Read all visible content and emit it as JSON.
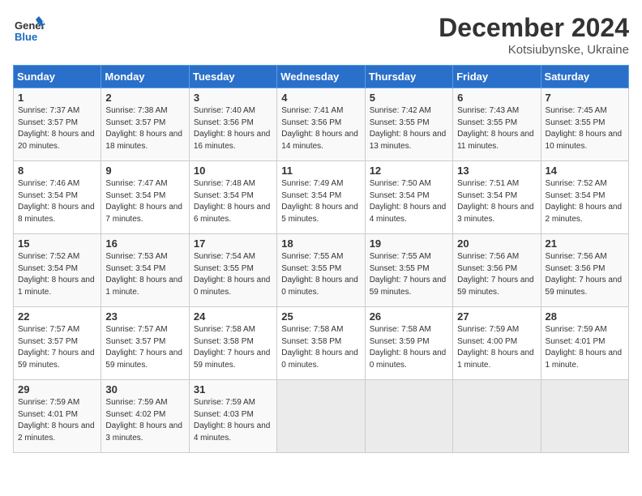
{
  "logo": {
    "general": "General",
    "blue": "Blue"
  },
  "title": "December 2024",
  "location": "Kotsiubynske, Ukraine",
  "weekdays": [
    "Sunday",
    "Monday",
    "Tuesday",
    "Wednesday",
    "Thursday",
    "Friday",
    "Saturday"
  ],
  "weeks": [
    [
      {
        "day": "1",
        "sunrise": "Sunrise: 7:37 AM",
        "sunset": "Sunset: 3:57 PM",
        "daylight": "Daylight: 8 hours and 20 minutes."
      },
      {
        "day": "2",
        "sunrise": "Sunrise: 7:38 AM",
        "sunset": "Sunset: 3:57 PM",
        "daylight": "Daylight: 8 hours and 18 minutes."
      },
      {
        "day": "3",
        "sunrise": "Sunrise: 7:40 AM",
        "sunset": "Sunset: 3:56 PM",
        "daylight": "Daylight: 8 hours and 16 minutes."
      },
      {
        "day": "4",
        "sunrise": "Sunrise: 7:41 AM",
        "sunset": "Sunset: 3:56 PM",
        "daylight": "Daylight: 8 hours and 14 minutes."
      },
      {
        "day": "5",
        "sunrise": "Sunrise: 7:42 AM",
        "sunset": "Sunset: 3:55 PM",
        "daylight": "Daylight: 8 hours and 13 minutes."
      },
      {
        "day": "6",
        "sunrise": "Sunrise: 7:43 AM",
        "sunset": "Sunset: 3:55 PM",
        "daylight": "Daylight: 8 hours and 11 minutes."
      },
      {
        "day": "7",
        "sunrise": "Sunrise: 7:45 AM",
        "sunset": "Sunset: 3:55 PM",
        "daylight": "Daylight: 8 hours and 10 minutes."
      }
    ],
    [
      {
        "day": "8",
        "sunrise": "Sunrise: 7:46 AM",
        "sunset": "Sunset: 3:54 PM",
        "daylight": "Daylight: 8 hours and 8 minutes."
      },
      {
        "day": "9",
        "sunrise": "Sunrise: 7:47 AM",
        "sunset": "Sunset: 3:54 PM",
        "daylight": "Daylight: 8 hours and 7 minutes."
      },
      {
        "day": "10",
        "sunrise": "Sunrise: 7:48 AM",
        "sunset": "Sunset: 3:54 PM",
        "daylight": "Daylight: 8 hours and 6 minutes."
      },
      {
        "day": "11",
        "sunrise": "Sunrise: 7:49 AM",
        "sunset": "Sunset: 3:54 PM",
        "daylight": "Daylight: 8 hours and 5 minutes."
      },
      {
        "day": "12",
        "sunrise": "Sunrise: 7:50 AM",
        "sunset": "Sunset: 3:54 PM",
        "daylight": "Daylight: 8 hours and 4 minutes."
      },
      {
        "day": "13",
        "sunrise": "Sunrise: 7:51 AM",
        "sunset": "Sunset: 3:54 PM",
        "daylight": "Daylight: 8 hours and 3 minutes."
      },
      {
        "day": "14",
        "sunrise": "Sunrise: 7:52 AM",
        "sunset": "Sunset: 3:54 PM",
        "daylight": "Daylight: 8 hours and 2 minutes."
      }
    ],
    [
      {
        "day": "15",
        "sunrise": "Sunrise: 7:52 AM",
        "sunset": "Sunset: 3:54 PM",
        "daylight": "Daylight: 8 hours and 1 minute."
      },
      {
        "day": "16",
        "sunrise": "Sunrise: 7:53 AM",
        "sunset": "Sunset: 3:54 PM",
        "daylight": "Daylight: 8 hours and 1 minute."
      },
      {
        "day": "17",
        "sunrise": "Sunrise: 7:54 AM",
        "sunset": "Sunset: 3:55 PM",
        "daylight": "Daylight: 8 hours and 0 minutes."
      },
      {
        "day": "18",
        "sunrise": "Sunrise: 7:55 AM",
        "sunset": "Sunset: 3:55 PM",
        "daylight": "Daylight: 8 hours and 0 minutes."
      },
      {
        "day": "19",
        "sunrise": "Sunrise: 7:55 AM",
        "sunset": "Sunset: 3:55 PM",
        "daylight": "Daylight: 7 hours and 59 minutes."
      },
      {
        "day": "20",
        "sunrise": "Sunrise: 7:56 AM",
        "sunset": "Sunset: 3:56 PM",
        "daylight": "Daylight: 7 hours and 59 minutes."
      },
      {
        "day": "21",
        "sunrise": "Sunrise: 7:56 AM",
        "sunset": "Sunset: 3:56 PM",
        "daylight": "Daylight: 7 hours and 59 minutes."
      }
    ],
    [
      {
        "day": "22",
        "sunrise": "Sunrise: 7:57 AM",
        "sunset": "Sunset: 3:57 PM",
        "daylight": "Daylight: 7 hours and 59 minutes."
      },
      {
        "day": "23",
        "sunrise": "Sunrise: 7:57 AM",
        "sunset": "Sunset: 3:57 PM",
        "daylight": "Daylight: 7 hours and 59 minutes."
      },
      {
        "day": "24",
        "sunrise": "Sunrise: 7:58 AM",
        "sunset": "Sunset: 3:58 PM",
        "daylight": "Daylight: 7 hours and 59 minutes."
      },
      {
        "day": "25",
        "sunrise": "Sunrise: 7:58 AM",
        "sunset": "Sunset: 3:58 PM",
        "daylight": "Daylight: 8 hours and 0 minutes."
      },
      {
        "day": "26",
        "sunrise": "Sunrise: 7:58 AM",
        "sunset": "Sunset: 3:59 PM",
        "daylight": "Daylight: 8 hours and 0 minutes."
      },
      {
        "day": "27",
        "sunrise": "Sunrise: 7:59 AM",
        "sunset": "Sunset: 4:00 PM",
        "daylight": "Daylight: 8 hours and 1 minute."
      },
      {
        "day": "28",
        "sunrise": "Sunrise: 7:59 AM",
        "sunset": "Sunset: 4:01 PM",
        "daylight": "Daylight: 8 hours and 1 minute."
      }
    ],
    [
      {
        "day": "29",
        "sunrise": "Sunrise: 7:59 AM",
        "sunset": "Sunset: 4:01 PM",
        "daylight": "Daylight: 8 hours and 2 minutes."
      },
      {
        "day": "30",
        "sunrise": "Sunrise: 7:59 AM",
        "sunset": "Sunset: 4:02 PM",
        "daylight": "Daylight: 8 hours and 3 minutes."
      },
      {
        "day": "31",
        "sunrise": "Sunrise: 7:59 AM",
        "sunset": "Sunset: 4:03 PM",
        "daylight": "Daylight: 8 hours and 4 minutes."
      },
      null,
      null,
      null,
      null
    ]
  ]
}
